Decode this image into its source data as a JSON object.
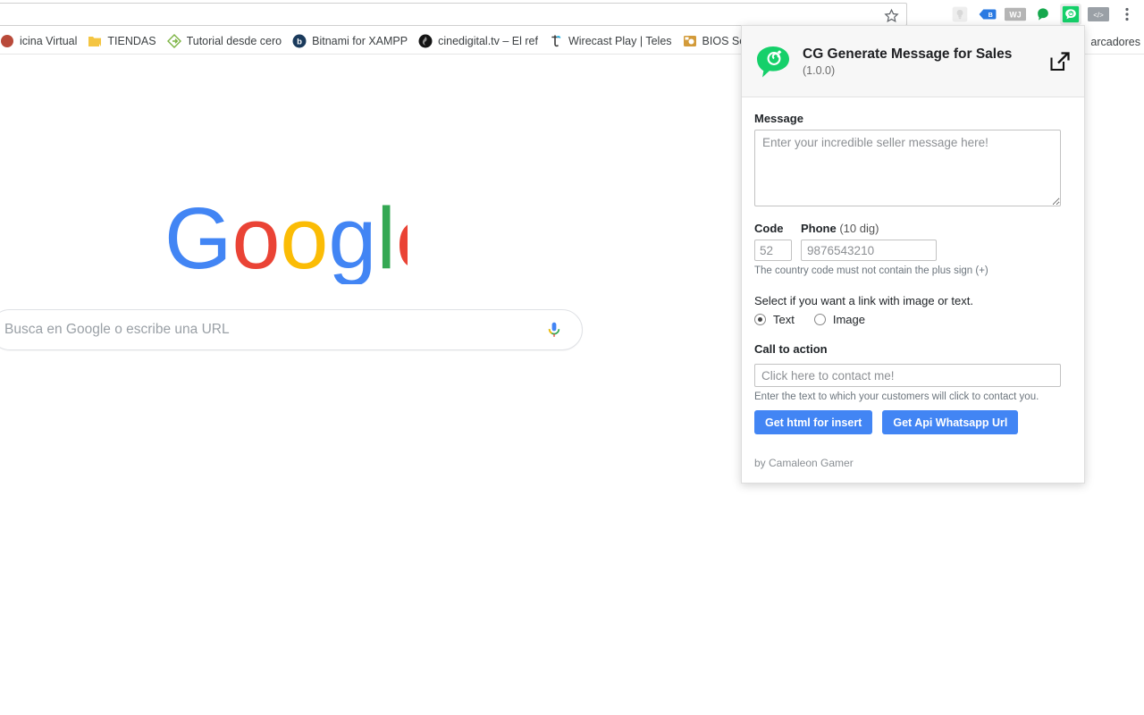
{
  "browser": {
    "omnibox_value": "",
    "toolbar_icons": [
      {
        "name": "bookmark-star-icon",
        "glyph": "☆"
      },
      {
        "name": "lightbulb-extension-icon",
        "color": "#e0e0e0"
      },
      {
        "name": "bluetag-extension-icon",
        "color": "#2a7ae2"
      },
      {
        "name": "wj-extension-icon",
        "color": "#b5b5b5",
        "label": "WJ"
      },
      {
        "name": "green-drop-extension-icon",
        "color": "#15a84d"
      },
      {
        "name": "cg-whatsapp-extension-icon",
        "color": "#15d06a"
      },
      {
        "name": "code-extension-icon",
        "color": "#9aa0a6",
        "label": "</>"
      },
      {
        "name": "chrome-menu-icon",
        "glyph": "⋮"
      }
    ],
    "bookmarks": [
      {
        "label": "icina Virtual",
        "icon": "globe-favicon",
        "color": "#b94a3a"
      },
      {
        "label": "TIENDAS",
        "icon": "folder-favicon",
        "color": "#f4c542"
      },
      {
        "label": "Tutorial desde cero ",
        "icon": "green-diamond-favicon",
        "color": "#7cb342"
      },
      {
        "label": "Bitnami for XAMPP ",
        "icon": "bitnami-favicon",
        "color": "#1a3a5c"
      },
      {
        "label": "cinedigital.tv – El ref",
        "icon": "cinedigital-favicon",
        "color": "#1a1a1a"
      },
      {
        "label": "Wirecast Play | Teles",
        "icon": "telestream-favicon",
        "color": "#1fb5e8"
      },
      {
        "label": "BIOS Se",
        "icon": "bios-favicon",
        "color": "#d39b3a"
      }
    ],
    "other_bookmarks_label": "arcadores"
  },
  "newtab": {
    "logo_name": "google-logo",
    "logo_letters": [
      {
        "char": "G",
        "color": "#4285f4"
      },
      {
        "char": "o",
        "color": "#ea4335"
      },
      {
        "char": "o",
        "color": "#fbbc05"
      },
      {
        "char": "g",
        "color": "#4285f4"
      },
      {
        "char": "l",
        "color": "#34a853"
      },
      {
        "char": "e",
        "color": "#ea4335"
      }
    ],
    "search_placeholder": "Busca en Google o escribe una URL",
    "search_value": "",
    "mic_icon_name": "microphone-icon"
  },
  "popup": {
    "title": "CG Generate Message for Sales",
    "version": "(1.0.0)",
    "logo_icon_name": "cg-chat-bubble-logo",
    "open_window_icon_name": "open-in-new-window-icon",
    "message": {
      "label": "Message",
      "placeholder": "Enter your incredible seller message here!",
      "value": ""
    },
    "code": {
      "label": "Code",
      "placeholder": "52",
      "value": ""
    },
    "phone": {
      "label": "Phone",
      "label_suffix": " (10 dig)",
      "placeholder": "9876543210",
      "value": ""
    },
    "phone_help": "The country code must not contain the plus sign (+)",
    "link_type": {
      "label": "Select if you want a link with image or text.",
      "options": [
        {
          "label": "Text",
          "selected": true
        },
        {
          "label": "Image",
          "selected": false
        }
      ]
    },
    "call_to_action": {
      "label": "Call to action",
      "placeholder": "Click here to contact me!",
      "value": "",
      "help": "Enter the text to which your customers will click to contact you."
    },
    "buttons": [
      {
        "label": "Get html for insert",
        "name": "get-html-for-insert-button"
      },
      {
        "label": "Get Api Whatsapp Url",
        "name": "get-api-whatsapp-url-button"
      }
    ],
    "credit": "by Camaleon Gamer",
    "accent_color": "#4285f4"
  }
}
